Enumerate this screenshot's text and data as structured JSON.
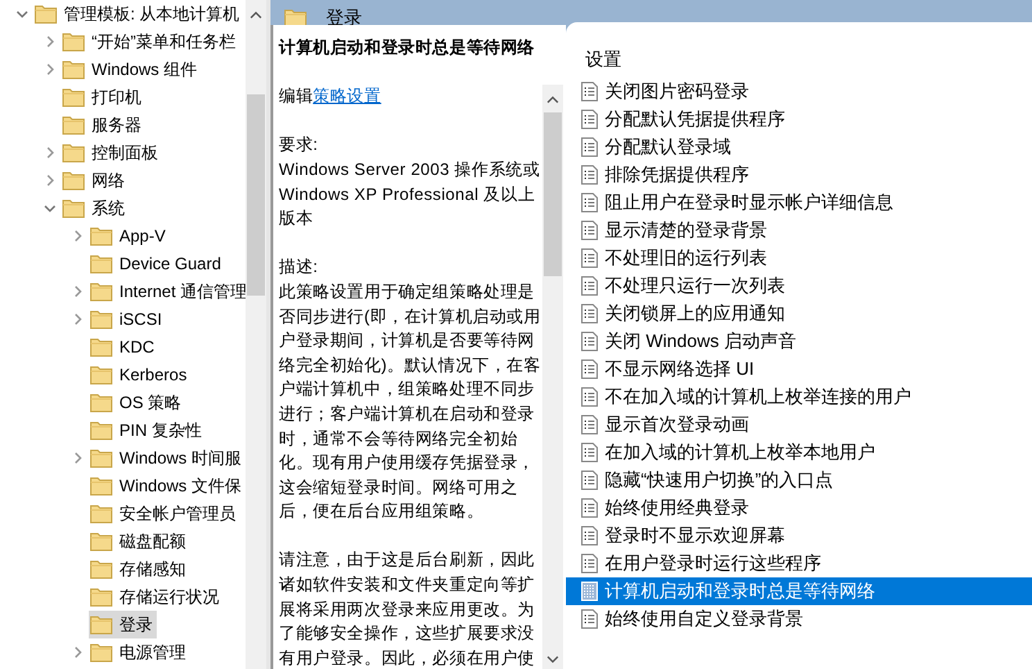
{
  "tree": [
    {
      "label": "管理模板: 从本地计算机",
      "expanded": true,
      "selected": false,
      "children": [
        {
          "label": "“开始”菜单和任务栏",
          "expanded": false,
          "selected": false
        },
        {
          "label": "Windows 组件",
          "expanded": false,
          "selected": false
        },
        {
          "label": "打印机",
          "selected": false
        },
        {
          "label": "服务器",
          "selected": false
        },
        {
          "label": "控制面板",
          "expanded": false,
          "selected": false
        },
        {
          "label": "网络",
          "expanded": false,
          "selected": false
        },
        {
          "label": "系统",
          "expanded": true,
          "selected": false,
          "children": [
            {
              "label": "App-V",
              "expanded": false,
              "selected": false
            },
            {
              "label": "Device Guard",
              "selected": false
            },
            {
              "label": "Internet 通信管理",
              "expanded": false,
              "selected": false
            },
            {
              "label": "iSCSI",
              "expanded": false,
              "selected": false
            },
            {
              "label": "KDC",
              "selected": false
            },
            {
              "label": "Kerberos",
              "selected": false
            },
            {
              "label": "OS 策略",
              "selected": false
            },
            {
              "label": "PIN 复杂性",
              "selected": false
            },
            {
              "label": "Windows 时间服",
              "expanded": false,
              "selected": false
            },
            {
              "label": "Windows 文件保",
              "selected": false
            },
            {
              "label": "安全帐户管理员",
              "selected": false
            },
            {
              "label": "磁盘配额",
              "selected": false
            },
            {
              "label": "存储感知",
              "selected": false
            },
            {
              "label": "存储运行状况",
              "selected": false
            },
            {
              "label": "登录",
              "selected": true
            },
            {
              "label": "电源管理",
              "expanded": false,
              "selected": false
            }
          ]
        }
      ]
    }
  ],
  "header": {
    "title": "登录"
  },
  "description": {
    "title": "计算机启动和登录时总是等待网络",
    "edit_prefix": "编辑",
    "edit_link": "策略设置",
    "requirements_label": "要求:",
    "requirements": "Windows Server 2003 操作系统或 Windows XP Professional 及以上版本",
    "description_label": "描述:",
    "paragraphs": [
      "此策略设置用于确定组策略处理是否同步进行(即，在计算机启动或用户登录期间，计算机是否要等待网络完全初始化)。默认情况下，在客户端计算机中，组策略处理不同步进行；客户端计算机在启动和登录时，通常不会等待网络完全初始化。现有用户使用缓存凭据登录，这会缩短登录时间。网络可用之后，便在后台应用组策略。",
      "请注意，由于这是后台刷新，因此诸如软件安装和文件夹重定向等扩展将采用两次登录来应用更改。为了能够安全操作，这些扩展要求没有用户登录。因此，必须在用户使"
    ]
  },
  "settings": {
    "heading": "设置",
    "items": [
      {
        "label": "关闭图片密码登录",
        "selected": false
      },
      {
        "label": "分配默认凭据提供程序",
        "selected": false
      },
      {
        "label": "分配默认登录域",
        "selected": false
      },
      {
        "label": "排除凭据提供程序",
        "selected": false
      },
      {
        "label": "阻止用户在登录时显示帐户详细信息",
        "selected": false
      },
      {
        "label": "显示清楚的登录背景",
        "selected": false
      },
      {
        "label": "不处理旧的运行列表",
        "selected": false
      },
      {
        "label": "不处理只运行一次列表",
        "selected": false
      },
      {
        "label": "关闭锁屏上的应用通知",
        "selected": false
      },
      {
        "label": "关闭 Windows 启动声音",
        "selected": false
      },
      {
        "label": "不显示网络选择 UI",
        "selected": false
      },
      {
        "label": "不在加入域的计算机上枚举连接的用户",
        "selected": false
      },
      {
        "label": "显示首次登录动画",
        "selected": false
      },
      {
        "label": "在加入域的计算机上枚举本地用户",
        "selected": false
      },
      {
        "label": "隐藏“快速用户切换”的入口点",
        "selected": false
      },
      {
        "label": "始终使用经典登录",
        "selected": false
      },
      {
        "label": "登录时不显示欢迎屏幕",
        "selected": false
      },
      {
        "label": "在用户登录时运行这些程序",
        "selected": false
      },
      {
        "label": "计算机启动和登录时总是等待网络",
        "selected": true
      },
      {
        "label": "始终使用自定义登录背景",
        "selected": false
      }
    ]
  }
}
